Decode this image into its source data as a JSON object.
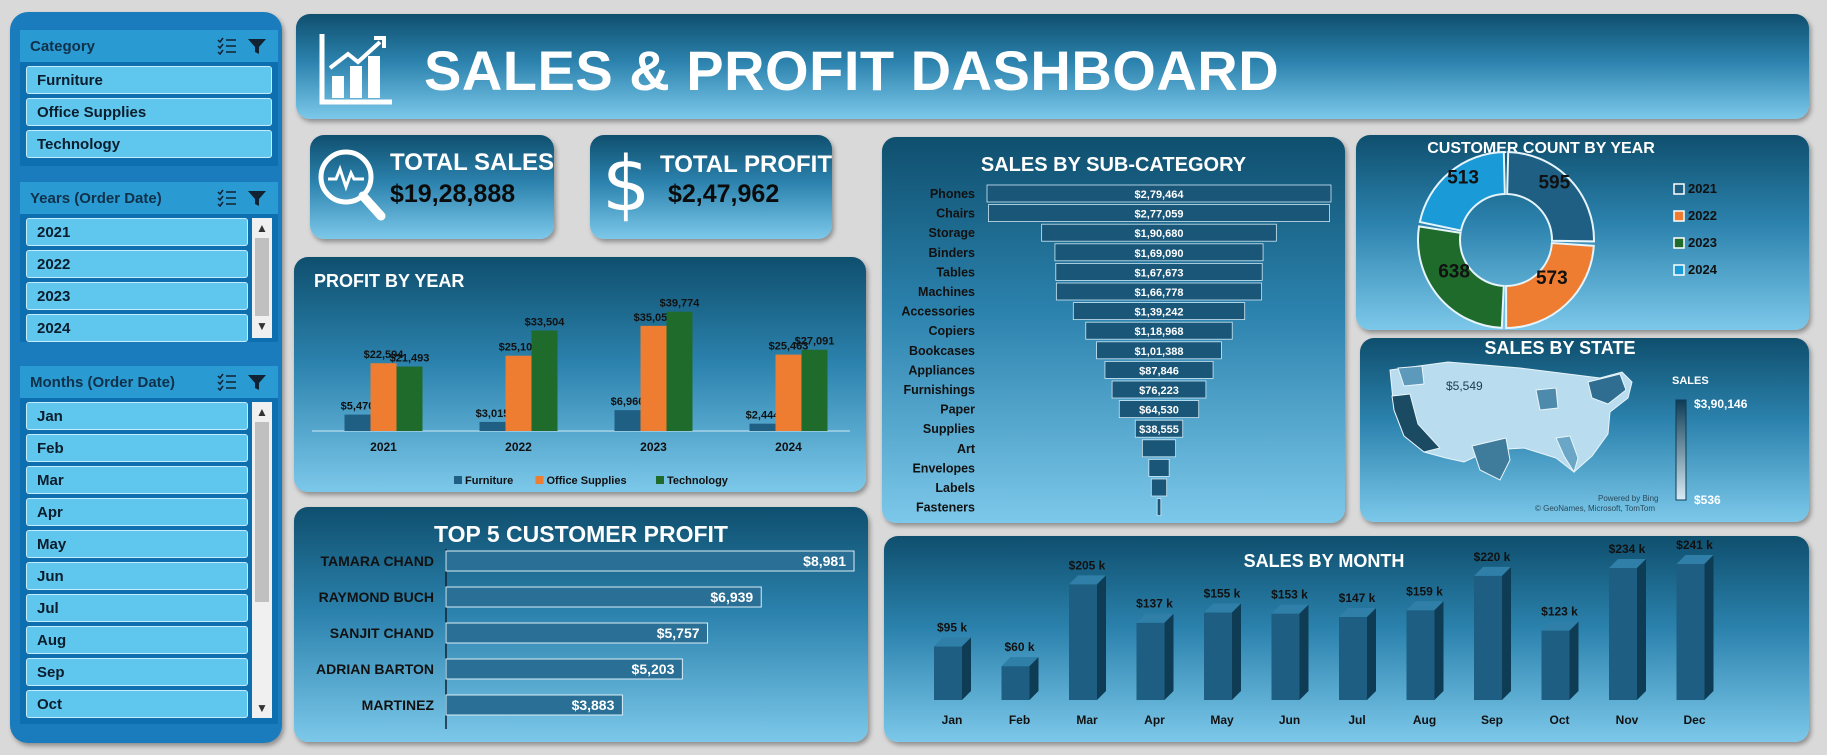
{
  "slicers": {
    "category": {
      "title": "Category",
      "items": [
        "Furniture",
        "Office Supplies",
        "Technology"
      ]
    },
    "years": {
      "title": "Years (Order Date)",
      "items": [
        "2021",
        "2022",
        "2023",
        "2024"
      ]
    },
    "months": {
      "title": "Months (Order Date)",
      "items": [
        "Jan",
        "Feb",
        "Mar",
        "Apr",
        "May",
        "Jun",
        "Jul",
        "Aug",
        "Sep",
        "Oct"
      ]
    }
  },
  "header": {
    "title": "SALES & PROFIT DASHBOARD"
  },
  "kpis": {
    "sales": {
      "label": "TOTAL SALES",
      "value": "$19,28,888"
    },
    "profit": {
      "label": "TOTAL PROFIT",
      "value": "$2,47,962"
    }
  },
  "profit_by_year": {
    "title": "PROFIT BY YEAR",
    "chart_data": {
      "type": "bar",
      "categories": [
        "2021",
        "2022",
        "2023",
        "2024"
      ],
      "series": [
        {
          "name": "Furniture",
          "values": [
            5470,
            3015,
            6960,
            2444
          ],
          "labels": [
            "$5,470",
            "$3,015",
            "$6,960",
            "$2,444"
          ],
          "color": "#1f5f84"
        },
        {
          "name": "Office Supplies",
          "values": [
            22594,
            25100,
            35053,
            25463
          ],
          "labels": [
            "$22,594",
            "$25,100",
            "$35,053",
            "$25,463"
          ],
          "color": "#ee7d31"
        },
        {
          "name": "Technology",
          "values": [
            21493,
            33504,
            39774,
            27091
          ],
          "labels": [
            "$21,493",
            "$33,504",
            "$39,774",
            "$27,091"
          ],
          "color": "#1f6b2c"
        }
      ],
      "ylim": [
        0,
        40000
      ]
    }
  },
  "top5": {
    "title": "TOP 5 CUSTOMER PROFIT",
    "chart_data": {
      "type": "bar",
      "categories": [
        "TAMARA CHAND",
        "RAYMOND BUCH",
        "SANJIT CHAND",
        "ADRIAN BARTON",
        "MARTINEZ"
      ],
      "values": [
        8981,
        6939,
        5757,
        5203,
        3883
      ],
      "labels": [
        "$8,981",
        "$6,939",
        "$5,757",
        "$5,203",
        "$3,883"
      ]
    }
  },
  "subcategory": {
    "title": "SALES BY SUB-CATEGORY",
    "chart_data": {
      "type": "bar",
      "categories": [
        "Phones",
        "Chairs",
        "Storage",
        "Binders",
        "Tables",
        "Machines",
        "Accessories",
        "Copiers",
        "Bookcases",
        "Appliances",
        "Furnishings",
        "Paper",
        "Supplies",
        "Art",
        "Envelopes",
        "Labels",
        "Fasteners"
      ],
      "values": [
        279464,
        277059,
        190680,
        169090,
        167673,
        166778,
        139242,
        118968,
        101388,
        87846,
        76223,
        64530,
        38555,
        27000,
        16500,
        12500,
        3000
      ],
      "labels": [
        "$2,79,464",
        "$2,77,059",
        "$1,90,680",
        "$1,69,090",
        "$1,67,673",
        "$1,66,778",
        "$1,39,242",
        "$1,18,968",
        "$1,01,388",
        "$87,846",
        "$76,223",
        "$64,530",
        "$38,555",
        "",
        "",
        "",
        ""
      ]
    }
  },
  "customer_count": {
    "title": "CUSTOMER COUNT BY YEAR",
    "chart_data": {
      "type": "pie",
      "categories": [
        "2021",
        "2022",
        "2023",
        "2024"
      ],
      "values": [
        595,
        573,
        638,
        513
      ],
      "colors": [
        "#1f5f84",
        "#ee7d31",
        "#1f6b2c",
        "#1a9ad6"
      ]
    }
  },
  "sales_by_state": {
    "title": "SALES BY STATE",
    "legend_title": "SALES",
    "max_label": "$3,90,146",
    "min_label": "$536",
    "callout": "$5,549",
    "attribution_1": "Powered by Bing",
    "attribution_2": "© GeoNames, Microsoft, TomTom"
  },
  "sales_by_month": {
    "title": "SALES BY MONTH",
    "chart_data": {
      "type": "bar",
      "categories": [
        "Jan",
        "Feb",
        "Mar",
        "Apr",
        "May",
        "Jun",
        "Jul",
        "Aug",
        "Sep",
        "Oct",
        "Nov",
        "Dec"
      ],
      "values": [
        95,
        60,
        205,
        137,
        155,
        153,
        147,
        159,
        220,
        123,
        234,
        241
      ],
      "labels": [
        "$95 k",
        "$60 k",
        "$205 k",
        "$137 k",
        "$155 k",
        "$153 k",
        "$147 k",
        "$159 k",
        "$220 k",
        "$123 k",
        "$234 k",
        "$241 k"
      ]
    }
  }
}
